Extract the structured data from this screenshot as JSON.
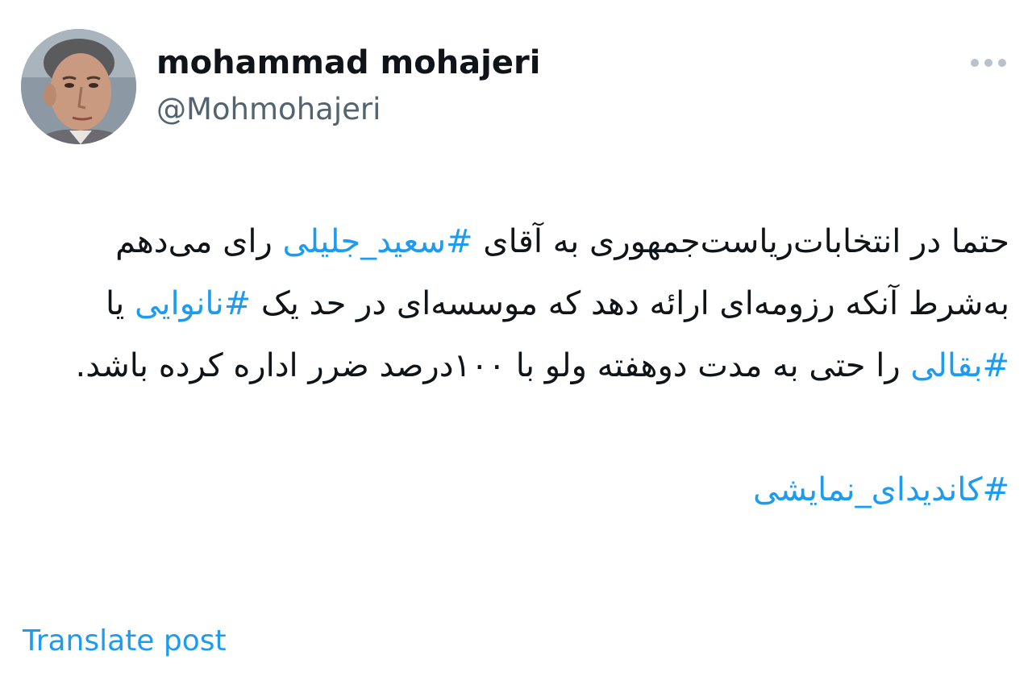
{
  "author": {
    "display_name": "mohammad mohajeri",
    "handle": "@Mohmohajeri",
    "avatar_icon": "profile-photo"
  },
  "menu": {
    "icon": "more-horizontal-icon"
  },
  "tweet": {
    "segments": [
      {
        "type": "text",
        "value": "حتما در انتخابات‌ریاست‌جمهوری به آقای "
      },
      {
        "type": "hashtag",
        "value": "#سعید_جلیلی"
      },
      {
        "type": "text",
        "value": " رای می‌دهم به‌شرط آنکه رزومه‌ای ارائه دهد که موسسه‌ای در حد یک "
      },
      {
        "type": "hashtag",
        "value": "#نانوایی"
      },
      {
        "type": "text",
        "value": " یا "
      },
      {
        "type": "hashtag",
        "value": "#بقالی"
      },
      {
        "type": "text",
        "value": " را حتی به مدت دوهفته ولو با ۱۰۰درصد ضرر اداره کرده باشد."
      }
    ],
    "footer_hashtag": "#کاندیدای_نمایشی"
  },
  "actions": {
    "translate_label": "Translate post"
  },
  "colors": {
    "text": "#0f1419",
    "secondary": "#536471",
    "link": "#1d9bf0"
  }
}
